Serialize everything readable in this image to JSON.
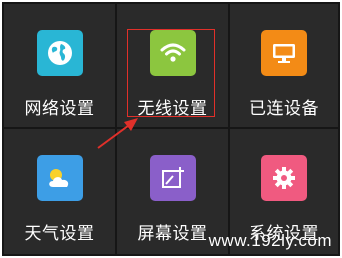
{
  "colors": {
    "background": "#161616",
    "tile": "#2a2a2a",
    "highlight": "#e0302a",
    "label": "#ffffff"
  },
  "tiles": [
    {
      "label": "网络设置",
      "icon": "globe-icon",
      "icon_color": "#29b6d5"
    },
    {
      "label": "无线设置",
      "icon": "wifi-icon",
      "icon_color": "#8cc63f"
    },
    {
      "label": "已连设备",
      "icon": "monitor-icon",
      "icon_color": "#f38b16"
    },
    {
      "label": "天气设置",
      "icon": "weather-icon",
      "icon_color": "#3d9ee6"
    },
    {
      "label": "屏幕设置",
      "icon": "screen-add-icon",
      "icon_color": "#8a5fc9"
    },
    {
      "label": "系统设置",
      "icon": "gear-icon",
      "icon_color": "#f05a80"
    }
  ],
  "watermark": "www.192ly.com"
}
